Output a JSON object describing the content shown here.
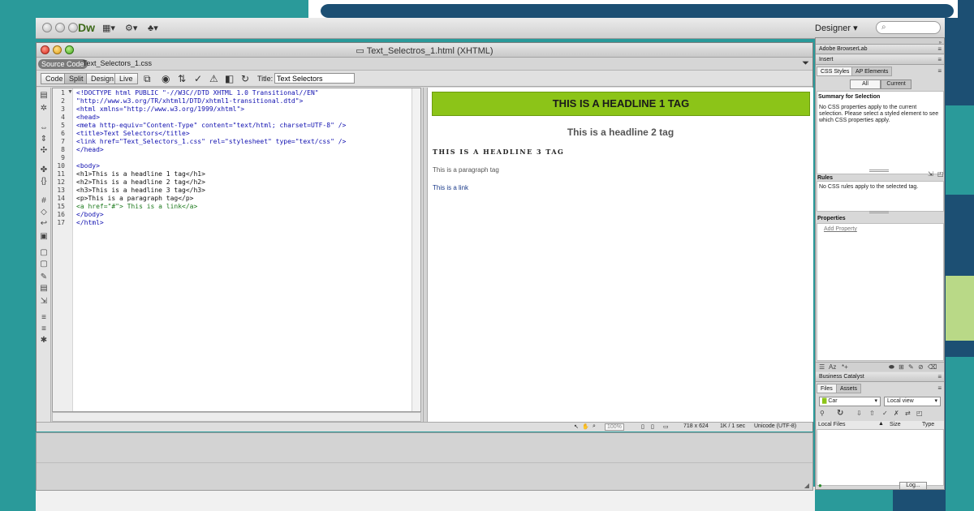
{
  "app": {
    "logo": "Dw",
    "workspace": "Designer",
    "workspace_caret": "▾",
    "search_placeholder": "⌕"
  },
  "document": {
    "window_title": "Text_Selectros_1.html (XHTML)",
    "source_code_tab": "Source Code",
    "related_file": "Text_Selectors_1.css",
    "view_buttons": [
      "Code",
      "Split",
      "Design",
      "Live"
    ],
    "title_label": "Title:",
    "title_value": "Text Selectors"
  },
  "code": {
    "line_numbers": [
      "1",
      "2",
      "3",
      "4",
      "5",
      "6",
      "7",
      "8",
      "9",
      "10",
      "11",
      "12",
      "13",
      "14",
      "15",
      "16",
      "17"
    ],
    "lines": [
      "<!DOCTYPE html PUBLIC \"-//W3C//DTD XHTML 1.0 Transitional//EN\"",
      "\"http://www.w3.org/TR/xhtml1/DTD/xhtml1-transitional.dtd\">",
      "<html xmlns=\"http://www.w3.org/1999/xhtml\">",
      "<head>",
      "<meta http-equiv=\"Content-Type\" content=\"text/html; charset=UTF-8\" />",
      "<title>Text Selectors</title>",
      "<link href=\"Text_Selectors_1.css\" rel=\"stylesheet\" type=\"text/css\" />",
      "</head>",
      "",
      "<body>",
      "<h1>This is a headline 1 tag</h1>",
      "<h2>This is a headline 2 tag</h2>",
      "<h3>This is a headline 3 tag</h3>",
      "<p>This is a paragraph tag</p>",
      "<a href=\"#\"> This is a link</a>",
      "</body>",
      "</html>"
    ]
  },
  "design": {
    "h1": "THIS IS A HEADLINE 1 TAG",
    "h2": "This is a headline 2 tag",
    "h3": "THIS IS A HEADLINE 3 TAG",
    "p": "This is a paragraph tag",
    "a": "This is a link",
    "h1_bg": "#8cc418"
  },
  "status": {
    "zoom": "100%",
    "dimensions": "718 x 624",
    "filesize": "1K / 1 sec",
    "encoding": "Unicode (UTF-8)"
  },
  "panels": {
    "browserlab": "Adobe BrowserLab",
    "insert": "Insert",
    "tabs": [
      "CSS Styles",
      "AP Elements"
    ],
    "mode_buttons": [
      "All",
      "Current"
    ],
    "summary_heading": "Summary for Selection",
    "summary_text": "No CSS properties apply to the current selection.  Please select a styled element to see which CSS properties apply.",
    "rules_heading": "Rules",
    "rules_text": "No CSS rules apply to the selected tag.",
    "properties_heading": "Properties",
    "add_property": "Add Property",
    "business_catalyst": "Business Catalyst",
    "file_tabs": [
      "Files",
      "Assets"
    ],
    "site": "Car",
    "view": "Local view",
    "columns": [
      "Local Files",
      "Size",
      "Type"
    ],
    "log_button": "Log..."
  }
}
